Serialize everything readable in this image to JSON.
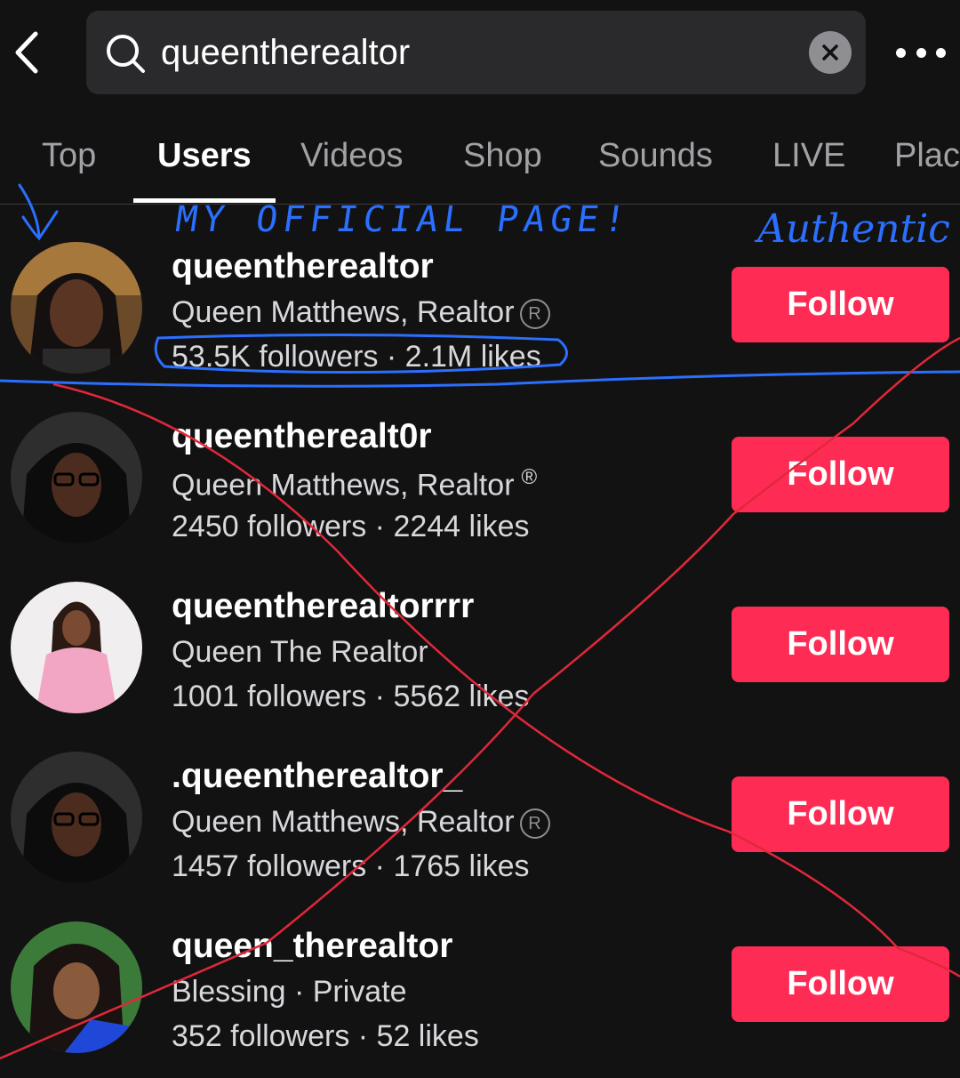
{
  "search": {
    "query": "queentherealtor"
  },
  "icons": {
    "back": "chevron-left-icon",
    "search": "search-icon",
    "clear": "close-icon",
    "more": "more-horizontal-icon"
  },
  "tabs": [
    {
      "label": "Top"
    },
    {
      "label": "Users"
    },
    {
      "label": "Videos"
    },
    {
      "label": "Shop"
    },
    {
      "label": "Sounds"
    },
    {
      "label": "LIVE"
    },
    {
      "label": "Plac"
    }
  ],
  "active_tab": "Users",
  "results": [
    {
      "username": "queentherealtor",
      "display_name": "Queen Matthews, Realtor",
      "registered_mark": "circle",
      "stats": "53.5K followers · 2.1M likes",
      "follow_label": "Follow"
    },
    {
      "username": "queentherealt0r",
      "display_name": "Queen Matthews, Realtor",
      "registered_mark": "plain",
      "stats": "2450 followers · 2244 likes",
      "follow_label": "Follow"
    },
    {
      "username": "queentherealtorrrr",
      "display_name": "Queen The Realtor",
      "registered_mark": "none",
      "stats": "1001 followers · 5562 likes",
      "follow_label": "Follow"
    },
    {
      "username": ".queentherealtor_",
      "display_name": "Queen Matthews, Realtor",
      "registered_mark": "circle",
      "stats": "1457 followers · 1765 likes",
      "follow_label": "Follow"
    },
    {
      "username": "queen_therealtor",
      "display_name": "Blessing · Private",
      "registered_mark": "none",
      "stats": "352 followers · 52 likes",
      "follow_label": "Follow"
    }
  ],
  "annotations": {
    "official_note": "MY OFFICIAL PAGE!",
    "authentic_note": "Authentic"
  },
  "colors": {
    "background": "#121212",
    "follow_button": "#fe2c55",
    "annotation_blue": "#2b6fff",
    "annotation_red": "#e0283a"
  }
}
